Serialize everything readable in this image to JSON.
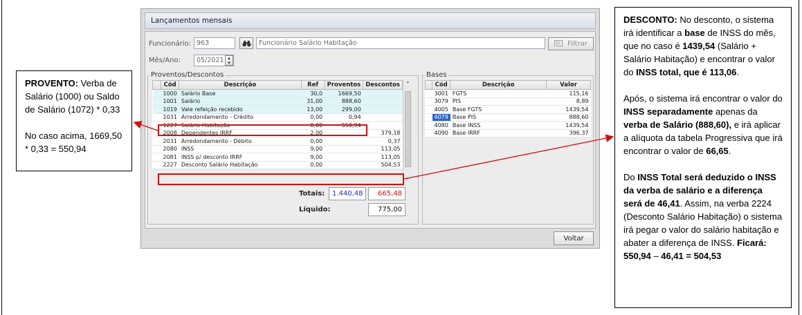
{
  "window": {
    "title": "Lançamentos mensais",
    "funcionario_label": "Funcionário:",
    "funcionario_code": "963",
    "funcionario_name": "Funcionário Salário Habitação",
    "mes_ano_label": "Mês/Ano:",
    "mes_ano_value": "05/2021",
    "filtrar_label": "Filtrar",
    "voltar_label": "Voltar"
  },
  "proventos": {
    "group_label": "Proventos/Descontos",
    "columns": [
      "Cód",
      "Descrição",
      "Ref",
      "Proventos",
      "Descontos"
    ],
    "rows": [
      {
        "cod": "1000",
        "desc": "Salário Base",
        "ref": "30,0",
        "prov": "1669,50",
        "desc_val": ""
      },
      {
        "cod": "1001",
        "desc": "Salário",
        "ref": "31,00",
        "prov": "888,60",
        "desc_val": ""
      },
      {
        "cod": "1019",
        "desc": "Vale refeição recebido",
        "ref": "13,00",
        "prov": "299,00",
        "desc_val": ""
      },
      {
        "cod": "1031",
        "desc": "Arredondamento - Crédito",
        "ref": "0,00",
        "prov": "0,94",
        "desc_val": ""
      },
      {
        "cod": "1227",
        "desc": "Salário Habitação",
        "ref": "0,00",
        "prov": "550,94",
        "desc_val": ""
      },
      {
        "cod": "2008",
        "desc": "Dependentes IRRF",
        "ref": "2,00",
        "prov": "",
        "desc_val": "379,18"
      },
      {
        "cod": "2031",
        "desc": "Arredondamento - Débito",
        "ref": "0,00",
        "prov": "",
        "desc_val": "0,37"
      },
      {
        "cod": "2080",
        "desc": "INSS",
        "ref": "9,00",
        "prov": "",
        "desc_val": "113,05"
      },
      {
        "cod": "2081",
        "desc": "INSS p/ desconto IRRF",
        "ref": "9,00",
        "prov": "",
        "desc_val": "113,05"
      },
      {
        "cod": "2227",
        "desc": "Desconto Salário Habitação",
        "ref": "0,00",
        "prov": "",
        "desc_val": "504,53"
      }
    ],
    "totais_label": "Totais:",
    "total_proventos": "1.440,48",
    "total_descontos": "665,48",
    "liquido_label": "Líquido:",
    "liquido_value": "775,00"
  },
  "bases": {
    "group_label": "Bases",
    "columns": [
      "Cód",
      "Descrição",
      "Valor"
    ],
    "rows": [
      {
        "cod": "3001",
        "desc": "FGTS",
        "valor": "115,16"
      },
      {
        "cod": "3079",
        "desc": "PIS",
        "valor": "8,89"
      },
      {
        "cod": "4005",
        "desc": "Base FGTS",
        "valor": "1439,54"
      },
      {
        "cod": "4079",
        "desc": "Base PIS",
        "valor": "888,60"
      },
      {
        "cod": "4080",
        "desc": "Base INSS",
        "valor": "1439,54"
      },
      {
        "cod": "4090",
        "desc": "Base IRRF",
        "valor": "396,37"
      }
    ]
  },
  "left_note": {
    "p1_bold": "PROVENTO:",
    "p1_text": " Verba de Salário (1000) ou Saldo de Salário (1072) * 0,33",
    "p2_text": "No caso acima, 1669,50 * 0,33 = 550,94"
  },
  "right_note": {
    "s1": "DESCONTO:",
    "s2": " No desconto, o sistema irá identificar a ",
    "s3": "base",
    "s4": " de INSS do mês, que no caso é ",
    "s5": "1439,54",
    "s6": " (Salário + Salário Habitação) e encontrar o valor do ",
    "s7": "INSS total, que é 113,06",
    "s8": ".",
    "s9": "Após, o sistema irá encontrar o valor do ",
    "s10": "INSS separadamente",
    "s11": " apenas da ",
    "s12": "verba de Salário (888,60),",
    "s13": " e irá aplicar a alíquota da tabela Progressiva que irá encontrar o valor de ",
    "s14": "66,65",
    "s15": ".",
    "s16": "Do ",
    "s17": "INSS Total será deduzido o INSS da verba de salário e a diferença será de 46,41",
    "s18": ". Assim, na verba 2224 (Desconto Salário Habitação) o sistema irá pegar o valor do salário habitação e abater a diferença de INSS. ",
    "s19": "Ficará: 550,94",
    "s20": " – ",
    "s21": "46,41 = 504,53"
  },
  "colors": {
    "accent_red": "#d21010",
    "select_blue": "#2b64c6",
    "row_highlight": "#dff5f7"
  }
}
